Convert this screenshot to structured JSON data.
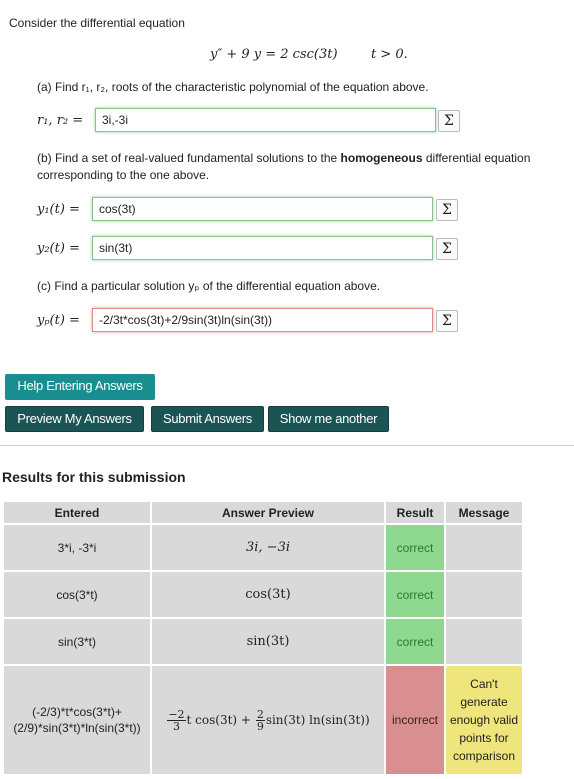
{
  "problem": {
    "intro": "Consider the differential equation",
    "equation": "y″ + 9 y = 2 csc(3t)",
    "condition": "t > 0.",
    "part_a": "(a) Find r₁, r₂, roots of the characteristic polynomial of the equation above.",
    "label_r": "r₁, r₂ =",
    "value_r": "3i,-3i",
    "part_b_pre": "(b) Find a set of real-valued fundamental solutions to the ",
    "part_b_bold": "homogeneous",
    "part_b_post": " differential equation corresponding to the one above.",
    "label_y1": "y₁(t) =",
    "value_y1": "cos(3t)",
    "label_y2": "y₂(t) =",
    "value_y2": "sin(3t)",
    "part_c": "(c) Find a particular solution yₚ of the differential equation above.",
    "label_yp": "yₚ(t) =",
    "value_yp": "-2/3t*cos(3t)+2/9sin(3t)ln(sin(3t))",
    "sigma_icon": "Σ"
  },
  "buttons": {
    "help": "Help Entering Answers",
    "preview": "Preview My Answers",
    "submit": "Submit Answers",
    "another": "Show me another"
  },
  "results": {
    "title": "Results for this submission",
    "headers": [
      "Entered",
      "Answer Preview",
      "Result",
      "Message"
    ],
    "rows": [
      {
        "entered": "3*i, -3*i",
        "preview": "3i, −3i",
        "result": "correct",
        "message": ""
      },
      {
        "entered": "cos(3*t)",
        "preview": "cos(3t)",
        "result": "correct",
        "message": ""
      },
      {
        "entered": "sin(3*t)",
        "preview": "sin(3t)",
        "result": "correct",
        "message": ""
      },
      {
        "entered_line1": "(-2/3)*t*cos(3*t)+",
        "entered_line2": "(2/9)*sin(3*t)*ln(sin(3*t))",
        "preview_frac1_num": "−2",
        "preview_frac1_den": "3",
        "preview_mid": "t cos(3t) +",
        "preview_frac2_num": "2",
        "preview_frac2_den": "9",
        "preview_end": "sin(3t) ln(sin(3t))",
        "result": "incorrect",
        "message": "Can't generate enough valid points for comparison"
      }
    ]
  },
  "colors": {
    "correct": "#8fd88f",
    "incorrect": "#d98f8f",
    "warning": "#efe57d",
    "button": "#1b5454",
    "button_help": "#198e91"
  }
}
